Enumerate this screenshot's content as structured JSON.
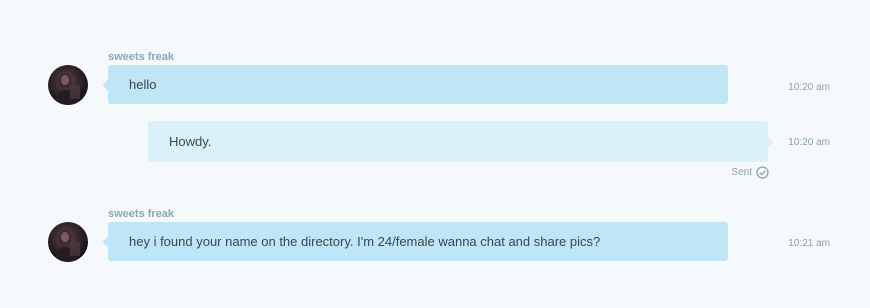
{
  "messages": [
    {
      "sender": "sweets freak",
      "text": "hello",
      "time": "10:20 am"
    },
    {
      "text": "Howdy.",
      "time": "10:20 am",
      "status": "Sent"
    },
    {
      "sender": "sweets freak",
      "text": "hey i found your name on the directory. I'm 24/female wanna chat and share pics?",
      "time": "10:21 am"
    }
  ],
  "icons": {
    "avatar": "user-photo-avatar",
    "status": "check-circle-icon"
  },
  "colors": {
    "background": "#f5f9fc",
    "incoming_bubble": "#bfe6f7",
    "outgoing_bubble": "#daf1fa",
    "sender_name": "#8aa6b8",
    "meta_text": "#8aa0ae"
  }
}
